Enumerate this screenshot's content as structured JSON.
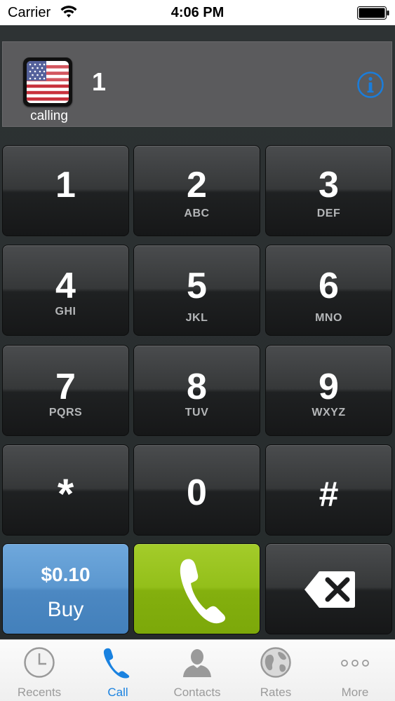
{
  "status_bar": {
    "carrier": "Carrier",
    "time": "4:06 PM"
  },
  "display": {
    "country_flag": "us-flag-icon",
    "status_label": "calling",
    "dialed_number": "1"
  },
  "keypad": {
    "keys": [
      {
        "digit": "1",
        "letters": ""
      },
      {
        "digit": "2",
        "letters": "ABC"
      },
      {
        "digit": "3",
        "letters": "DEF"
      },
      {
        "digit": "4",
        "letters": "GHI"
      },
      {
        "digit": "5",
        "letters": "JKL"
      },
      {
        "digit": "6",
        "letters": "MNO"
      },
      {
        "digit": "7",
        "letters": "PQRS"
      },
      {
        "digit": "8",
        "letters": "TUV"
      },
      {
        "digit": "9",
        "letters": "WXYZ"
      },
      {
        "digit": "*",
        "letters": ""
      },
      {
        "digit": "0",
        "letters": ""
      },
      {
        "digit": "#",
        "letters": ""
      }
    ],
    "buy": {
      "price": "$0.10",
      "label": "Buy",
      "color": "#5b97cf"
    },
    "call": {
      "icon": "phone-icon",
      "color": "#93bf1a"
    },
    "delete": {
      "icon": "backspace-icon"
    }
  },
  "tab_bar": {
    "active_color": "#1a82e0",
    "tabs": [
      {
        "label": "Recents",
        "icon": "clock-icon",
        "active": false
      },
      {
        "label": "Call",
        "icon": "phone-icon",
        "active": true
      },
      {
        "label": "Contacts",
        "icon": "person-icon",
        "active": false
      },
      {
        "label": "Rates",
        "icon": "globe-icon",
        "active": false
      },
      {
        "label": "More",
        "icon": "more-dots-icon",
        "active": false
      }
    ]
  }
}
